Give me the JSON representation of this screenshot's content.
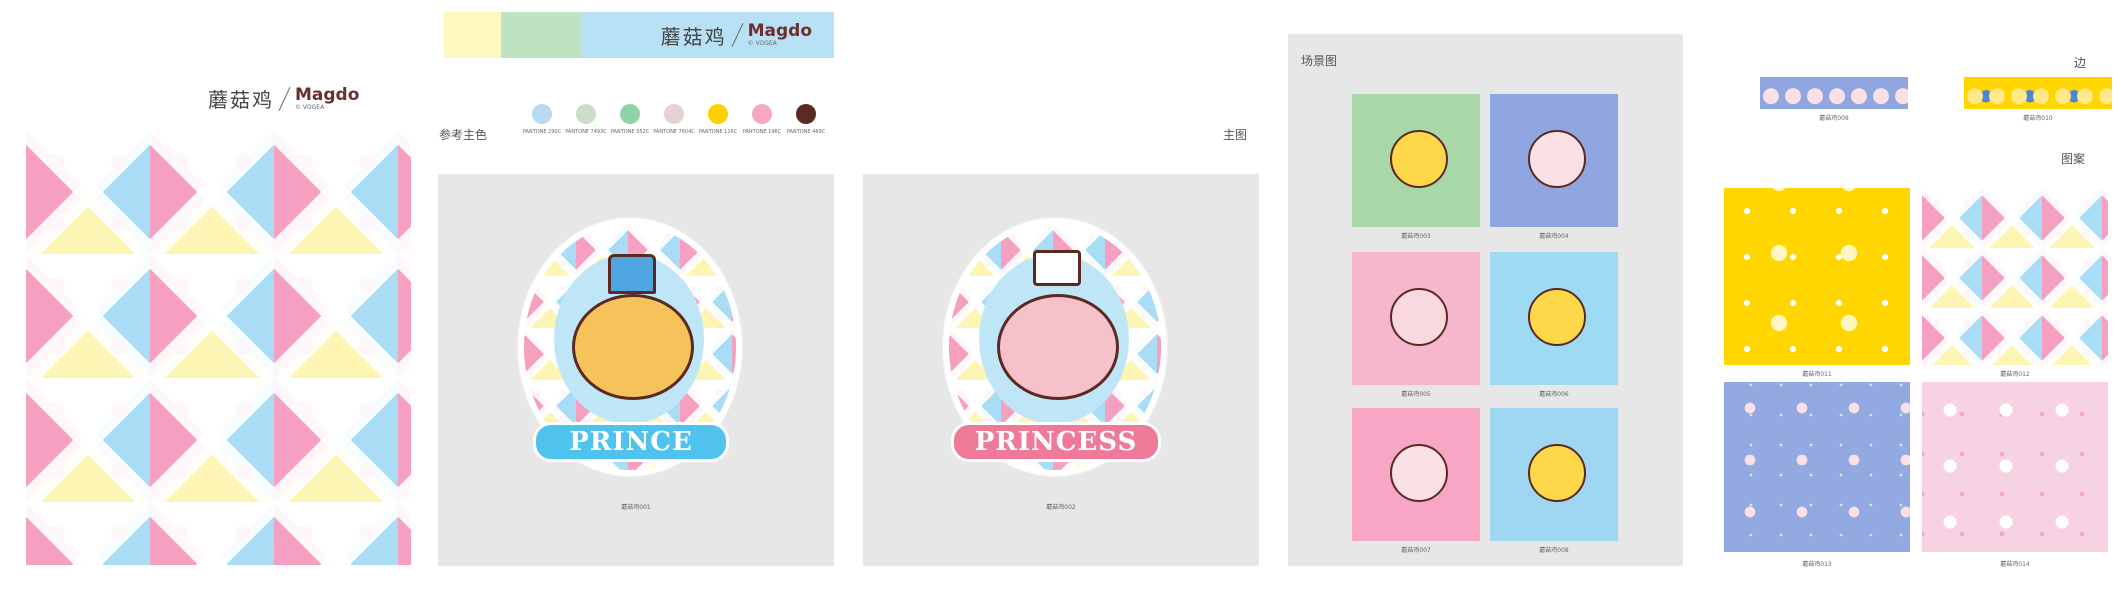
{
  "brand": {
    "name_cn": "蘑菇鸡",
    "logo": "Magdo",
    "logo_sub": "© VOGEA"
  },
  "colors": {
    "page_bg": "#ffffff",
    "panel_gray": "#e7e7e8",
    "pink": "#f28fb0",
    "blue": "#61c8ef",
    "yellow": "#ffd500",
    "brown": "#5a2a22"
  },
  "top_strip": {
    "swatches": [
      "#fdf8bf",
      "#bfe3c2",
      "#b9e1f6"
    ]
  },
  "ref_colors": {
    "label": "参考主色",
    "swatches": [
      {
        "hex": "#b7d9f1",
        "pantone": "PANTONE 290C"
      },
      {
        "hex": "#c8dfc6",
        "pantone": "PANTONE 7493C"
      },
      {
        "hex": "#8fd3a6",
        "pantone": "PANTONE 352C"
      },
      {
        "hex": "#ead1d1",
        "pantone": "PANTONE 7604C"
      },
      {
        "hex": "#ffd100",
        "pantone": "PANTONE 116C"
      },
      {
        "hex": "#f7a8c0",
        "pantone": "PANTONE 196C"
      },
      {
        "hex": "#5b2a22",
        "pantone": "PANTONE 469C"
      }
    ]
  },
  "main_label": "主图",
  "main_images": [
    {
      "banner": "PRINCE",
      "caption": "蘑菇鸡001",
      "banner_color": "#4fc3ee"
    },
    {
      "banner": "PRINCESS",
      "caption": "蘑菇鸡002",
      "banner_color": "#ee7a98"
    }
  ],
  "scene": {
    "label": "场景图",
    "items": [
      {
        "caption": "蘑菇鸡003",
        "bg": "#a9d8a8",
        "fig": "#ffd84a"
      },
      {
        "caption": "蘑菇鸡004",
        "bg": "#8fa6e0",
        "fig": "#fbe1e6"
      },
      {
        "caption": "蘑菇鸡005",
        "bg": "#f6b6cd",
        "fig": "#f9d8df"
      },
      {
        "caption": "蘑菇鸡006",
        "bg": "#9fdaf3",
        "fig": "#ffd84a"
      },
      {
        "caption": "蘑菇鸡007",
        "bg": "#f7a6c6",
        "fig": "#fbe1e6"
      },
      {
        "caption": "蘑菇鸡008",
        "bg": "#9fd6f2",
        "fig": "#ffd84a"
      }
    ]
  },
  "border": {
    "label": "边",
    "items": [
      {
        "caption": "蘑菇鸡009",
        "bg": "#8fa6e0"
      },
      {
        "caption": "蘑菇鸡010",
        "bg": "#ffd600"
      }
    ]
  },
  "pattern": {
    "label": "图案",
    "items": [
      {
        "caption": "蘑菇鸡011",
        "bg": "#ffd600"
      },
      {
        "caption": "蘑菇鸡012",
        "bg": "#fff7d4"
      },
      {
        "caption": "蘑菇鸡013",
        "bg": "#93a9e2"
      },
      {
        "caption": "蘑菇鸡014",
        "bg": "#f7d2e2"
      }
    ]
  }
}
